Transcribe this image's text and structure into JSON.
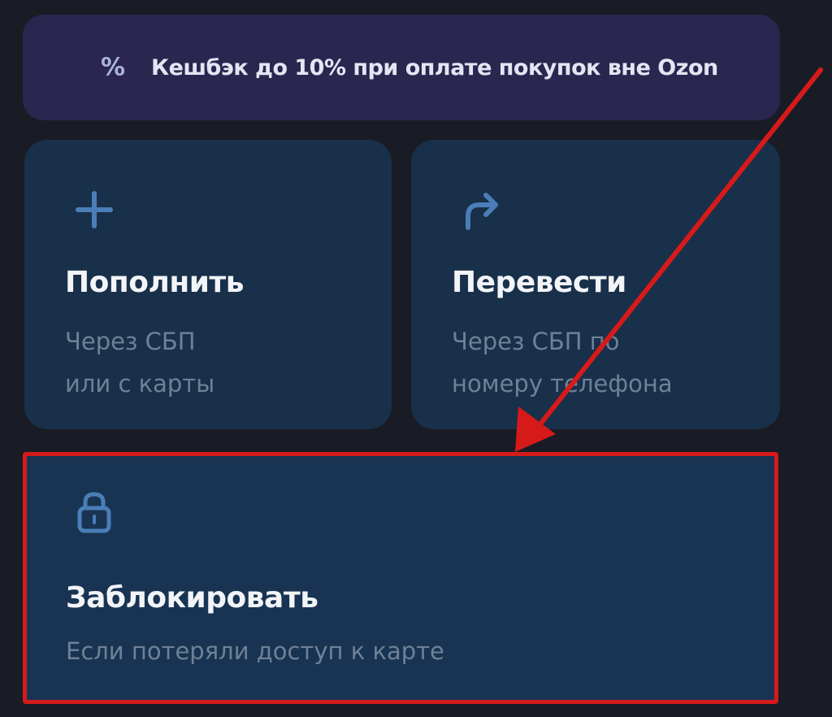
{
  "cashback": {
    "icon": "percent-icon",
    "icon_glyph": "%",
    "text": "Кешбэк до 10% при оплате покупок вне Ozon"
  },
  "actions": {
    "topup": {
      "icon": "plus-icon",
      "title": "Пополнить",
      "subtitle": "Через СБП\nили с карты"
    },
    "transfer": {
      "icon": "forward-arrow-icon",
      "title": "Перевести",
      "subtitle": "Через СБП по\nномеру телефона"
    },
    "block": {
      "icon": "lock-icon",
      "title": "Заблокировать",
      "subtitle": "Если потеряли доступ к карте"
    }
  },
  "colors": {
    "background": "#191c24",
    "cashback_bg": "#2a2650",
    "card_bg": "#19304a",
    "icon_blue": "#4a7eb8",
    "highlight_red": "#d61a1a"
  }
}
